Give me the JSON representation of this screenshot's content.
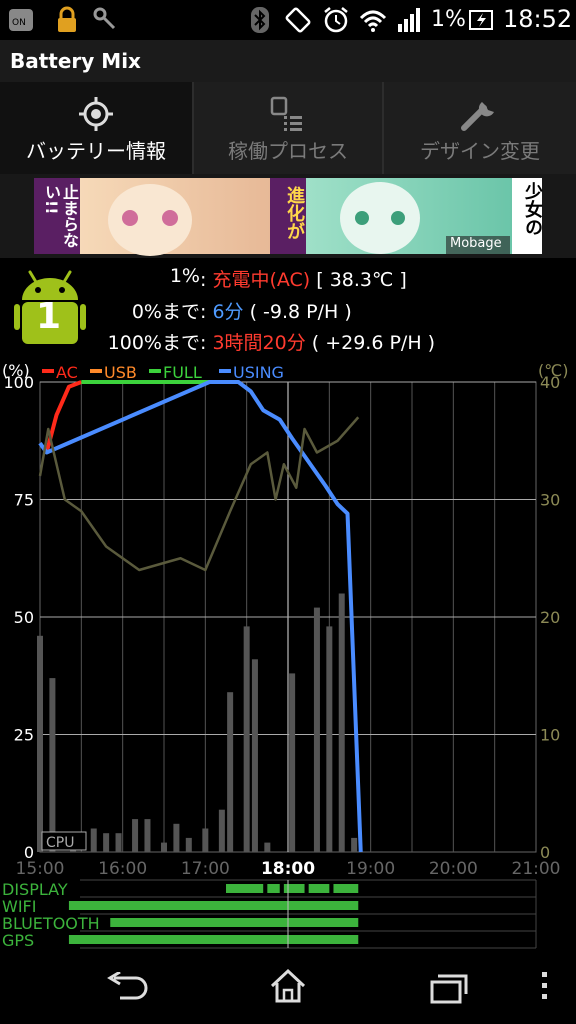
{
  "status_bar": {
    "battery_percent": "1%",
    "time": "18:52",
    "icons": [
      "ntt-docomo-icon",
      "lock-icon",
      "key-wifi-icon",
      "bluetooth-icon",
      "rotation-icon",
      "alarm-clock-icon",
      "wifi-icon",
      "signal-icon",
      "battery-charging-icon"
    ]
  },
  "app": {
    "title": "Battery Mix"
  },
  "tabs": [
    {
      "label": "バッテリー情報",
      "icon": "target-icon",
      "active": true
    },
    {
      "label": "稼働プロセス",
      "icon": "process-list-icon",
      "active": false
    },
    {
      "label": "デザイン変更",
      "icon": "wrench-icon",
      "active": false
    }
  ],
  "banner": {
    "text_left": "止まらない!!",
    "text_mid": "進化が",
    "text_right": "少女の",
    "brand": "Mobage"
  },
  "battery_badge": {
    "level": "1"
  },
  "info": {
    "line1": {
      "label": "1%",
      "sep": " : ",
      "status": "充電中(AC)",
      "temp": " [ 38.3℃ ]"
    },
    "line2": {
      "label": "0%まで",
      "sep": " : ",
      "time": "6分",
      "rate": " ( -9.8 P/H )"
    },
    "line3": {
      "label": "100%まで",
      "sep": " : ",
      "time": "3時間20分",
      "rate": " ( +29.6 P/H )"
    }
  },
  "chart_data": {
    "type": "line",
    "y_left_unit": "(%)",
    "y_right_unit": "(℃)",
    "y_left_ticks": [
      "100",
      "75",
      "50",
      "25",
      "0"
    ],
    "y_right_ticks": [
      "40",
      "30",
      "20",
      "10",
      "0"
    ],
    "ylim_left": [
      0,
      100
    ],
    "ylim_right": [
      0,
      40
    ],
    "x_ticks": [
      "15:00",
      "16:00",
      "17:00",
      "18:00",
      "19:00",
      "20:00",
      "21:00"
    ],
    "x_current": "18:00",
    "xlim_hours": [
      15,
      21
    ],
    "legend": [
      {
        "name": "AC",
        "color": "#ff2a1a"
      },
      {
        "name": "USB",
        "color": "#ff8a2a"
      },
      {
        "name": "FULL",
        "color": "#3cd23c"
      },
      {
        "name": "USING",
        "color": "#4a8cff"
      }
    ],
    "series": [
      {
        "name": "AC",
        "color": "#ff2a1a",
        "x": [
          15.08,
          15.2,
          15.35,
          15.5
        ],
        "y": [
          85,
          93,
          99,
          100
        ]
      },
      {
        "name": "FULL",
        "color": "#3cd23c",
        "x": [
          15.5,
          16.0,
          16.5,
          17.05
        ],
        "y": [
          100,
          100,
          100,
          100
        ]
      },
      {
        "name": "USING",
        "color": "#4a8cff",
        "x": [
          15.0,
          15.08,
          17.05,
          17.4,
          17.55,
          17.7,
          17.9,
          18.05,
          18.25,
          18.45,
          18.6,
          18.72,
          18.88
        ],
        "y": [
          87,
          85,
          100,
          100,
          98,
          94,
          92,
          88,
          83,
          78,
          74,
          72,
          0
        ]
      },
      {
        "name": "temperature",
        "color": "#5a5a3c",
        "x": [
          15.0,
          15.1,
          15.3,
          15.5,
          15.8,
          16.2,
          16.7,
          17.0,
          17.3,
          17.55,
          17.75,
          17.85,
          17.95,
          18.1,
          18.2,
          18.35,
          18.6,
          18.85
        ],
        "y": [
          32,
          36,
          30,
          29,
          26,
          24,
          25,
          24,
          29,
          33,
          34,
          30,
          33,
          31,
          36,
          34,
          35,
          37
        ]
      }
    ],
    "cpu_label": "CPU",
    "cpu_bars": {
      "x": [
        15.0,
        15.15,
        15.4,
        15.65,
        15.8,
        15.95,
        16.15,
        16.3,
        16.5,
        16.65,
        16.8,
        17.0,
        17.2,
        17.3,
        17.5,
        17.6,
        17.75,
        18.05,
        18.35,
        18.5,
        18.65,
        18.8
      ],
      "y": [
        46,
        37,
        2,
        5,
        4,
        4,
        7,
        7,
        2,
        6,
        3,
        5,
        9,
        34,
        48,
        41,
        2,
        38,
        52,
        48,
        55,
        3
      ]
    },
    "rows": [
      {
        "name": "DISPLAY"
      },
      {
        "name": "WIFI"
      },
      {
        "name": "BLUETOOTH"
      },
      {
        "name": "GPS"
      }
    ]
  },
  "nav": {
    "back": "back-icon",
    "home": "home-icon",
    "recent": "recent-apps-icon",
    "menu": "overflow-menu-icon"
  }
}
